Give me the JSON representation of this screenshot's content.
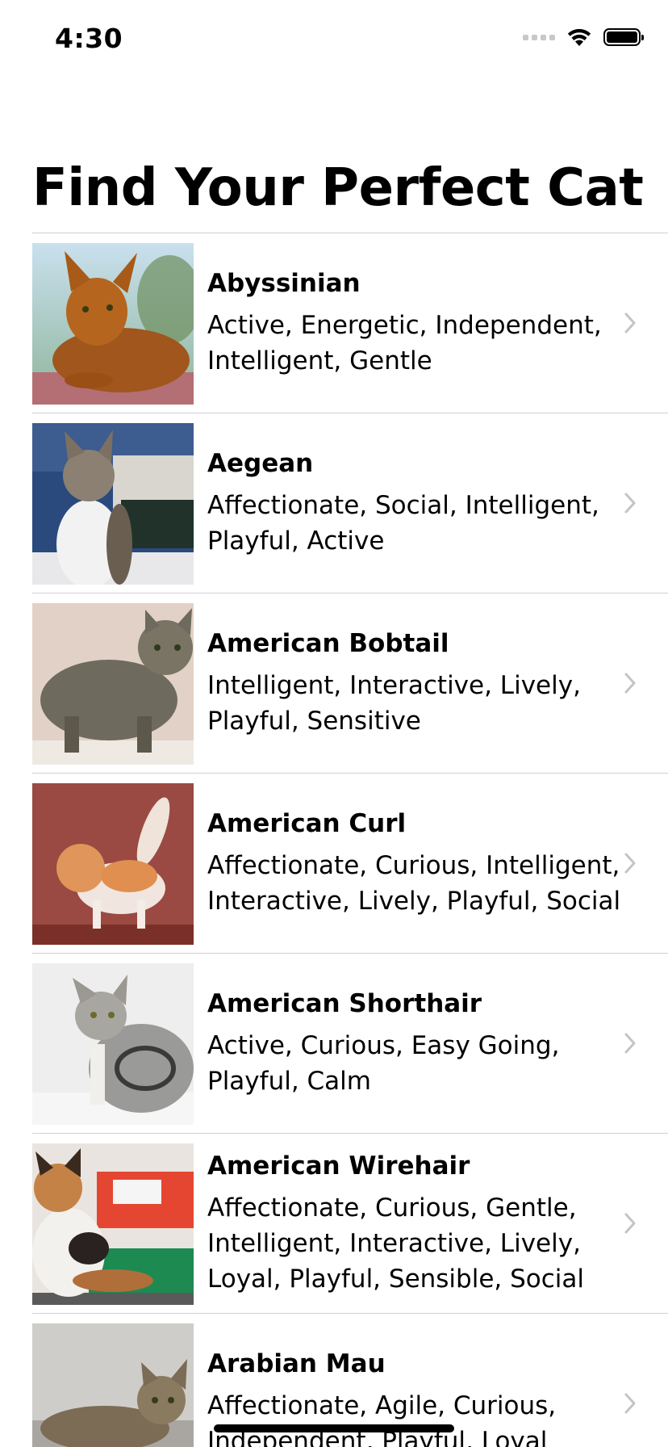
{
  "status_bar": {
    "time": "4:30",
    "icons": [
      "cellular-signal-icon",
      "wifi-icon",
      "battery-icon"
    ]
  },
  "title": "Find Your Perfect Cat",
  "breeds": [
    {
      "name": "Abyssinian",
      "traits": "Active, Energetic, Independent, Intelligent, Gentle"
    },
    {
      "name": "Aegean",
      "traits": "Affectionate, Social, Intelligent, Playful, Active"
    },
    {
      "name": "American Bobtail",
      "traits": "Intelligent, Interactive, Lively, Playful, Sensitive"
    },
    {
      "name": "American Curl",
      "traits": "Affectionate, Curious, Intelligent, Interactive, Lively, Playful, Social"
    },
    {
      "name": "American Shorthair",
      "traits": "Active, Curious, Easy Going, Playful, Calm"
    },
    {
      "name": "American Wirehair",
      "traits": "Affectionate, Curious, Gentle, Intelligent, Interactive, Lively, Loyal, Playful, Sensible, Social"
    },
    {
      "name": "Arabian Mau",
      "traits": "Affectionate, Agile, Curious, Independent, Playful, Loyal"
    }
  ],
  "colors": {
    "separator": "#d1d1d6",
    "chevron": "#c4c4c7",
    "text": "#000000"
  }
}
